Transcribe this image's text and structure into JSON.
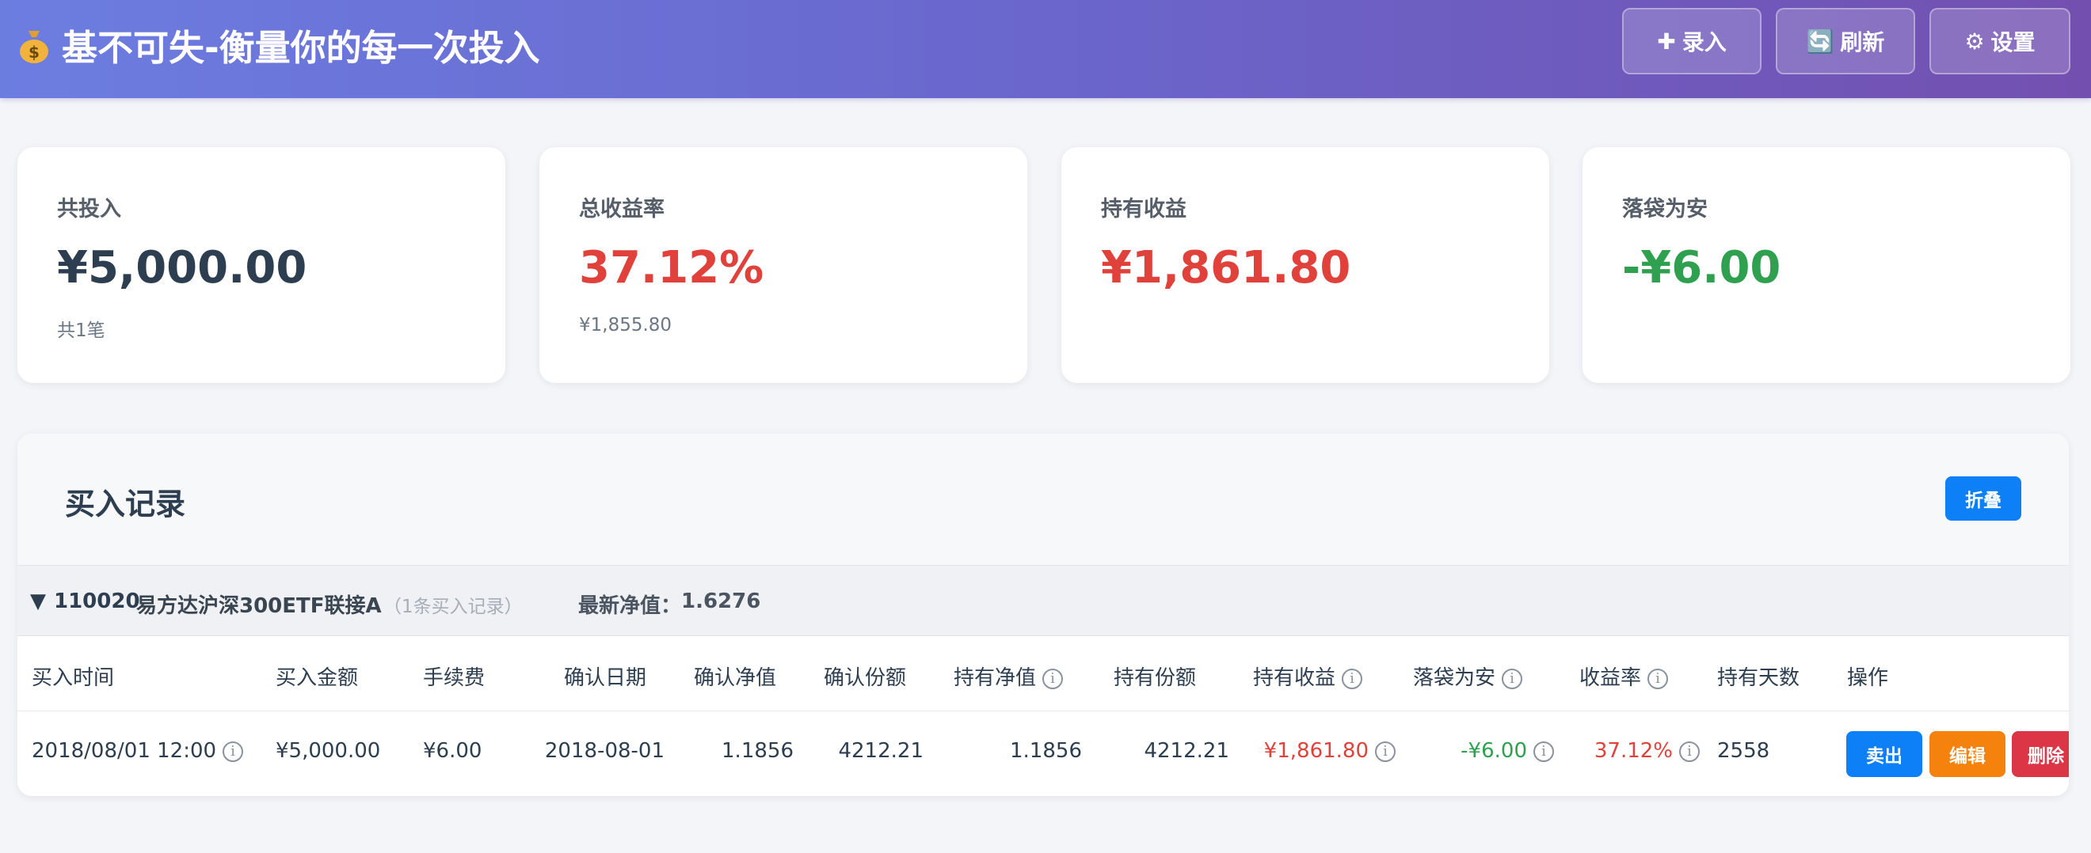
{
  "header": {
    "title": "基不可失-衡量你的每一次投入",
    "icon": "money-bag-icon",
    "buttons": {
      "add": {
        "label": "录入",
        "icon": "plus-icon"
      },
      "refresh": {
        "label": "刷新",
        "icon": "refresh-icon"
      },
      "settings": {
        "label": "设置",
        "icon": "gear-icon"
      }
    }
  },
  "summary": {
    "total_invested": {
      "label": "共投入",
      "value": "¥5,000.00",
      "sub": "共1笔"
    },
    "total_return": {
      "label": "总收益率",
      "value": "37.12%",
      "sub": "¥1,855.80"
    },
    "holding_profit": {
      "label": "持有收益",
      "value": "¥1,861.80"
    },
    "realized": {
      "label": "落袋为安",
      "value": "-¥6.00"
    }
  },
  "records": {
    "title": "买入记录",
    "fold_label": "折叠",
    "group": {
      "toggle": "▼",
      "code": "110020",
      "name": "易方达沪深300ETF联接A",
      "count": "（1条买入记录）",
      "nav_label": "最新净值：",
      "nav_value": "1.6276"
    },
    "columns": {
      "buy_time": "买入时间",
      "amount": "买入金额",
      "fee": "手续费",
      "confirm_date": "确认日期",
      "confirm_nav": "确认净值",
      "confirm_shares": "确认份额",
      "hold_nav": "持有净值",
      "hold_shares": "持有份额",
      "hold_profit": "持有收益",
      "realized": "落袋为安",
      "return_rate": "收益率",
      "hold_days": "持有天数",
      "actions": "操作"
    },
    "rows": [
      {
        "buy_time": "2018/08/01 12:00",
        "amount": "¥5,000.00",
        "fee": "¥6.00",
        "confirm_date": "2018-08-01",
        "confirm_nav": "1.1856",
        "confirm_shares": "4212.21",
        "hold_nav": "1.1856",
        "hold_shares": "4212.21",
        "hold_profit": "¥1,861.80",
        "realized": "-¥6.00",
        "return_rate": "37.12%",
        "hold_days": "2558",
        "sell_label": "卖出",
        "edit_label": "编辑",
        "delete_label": "删除"
      }
    ]
  },
  "colors": {
    "positive": "#e0413a",
    "negative": "#2ea04f",
    "primary": "#0d7ff7",
    "edit": "#f5820d",
    "delete": "#dc3545"
  }
}
